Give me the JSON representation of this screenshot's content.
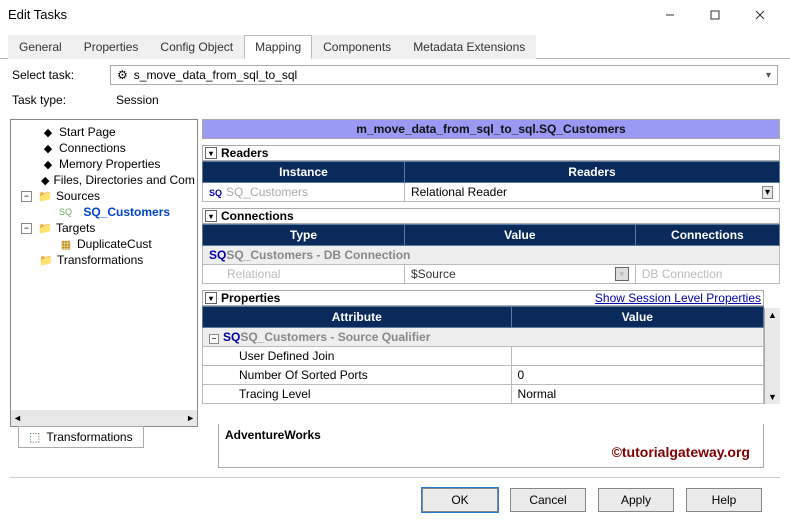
{
  "window": {
    "title": "Edit Tasks"
  },
  "tabs": [
    {
      "label": "General"
    },
    {
      "label": "Properties"
    },
    {
      "label": "Config Object"
    },
    {
      "label": "Mapping"
    },
    {
      "label": "Components"
    },
    {
      "label": "Metadata Extensions"
    }
  ],
  "active_tab": 3,
  "task": {
    "select_label": "Select task:",
    "value": "s_move_data_from_sql_to_sql",
    "type_label": "Task type:",
    "type_value": "Session"
  },
  "tree": {
    "items": [
      "Start Page",
      "Connections",
      "Memory Properties",
      "Files, Directories and Com"
    ],
    "sources": {
      "label": "Sources",
      "children": [
        "SQ_Customers"
      ]
    },
    "targets": {
      "label": "Targets",
      "children": [
        "DuplicateCust"
      ]
    },
    "transformations": {
      "label": "Transformations"
    }
  },
  "mapping_title": "m_move_data_from_sql_to_sql.SQ_Customers",
  "readers": {
    "title": "Readers",
    "headers": [
      "Instance",
      "Readers"
    ],
    "row": {
      "instance": "SQ_Customers",
      "reader": "Relational Reader"
    }
  },
  "connections": {
    "title": "Connections",
    "headers": [
      "Type",
      "Value",
      "Connections"
    ],
    "group": "SQ_Customers - DB Connection",
    "relational_label": "Relational",
    "source_value": "$Source",
    "conn_label": "DB Connection"
  },
  "properties": {
    "title": "Properties",
    "link": "Show Session Level Properties",
    "headers": [
      "Attribute",
      "Value"
    ],
    "group": "SQ_Customers - Source Qualifier",
    "rows": [
      {
        "attr": "User Defined Join",
        "val": ""
      },
      {
        "attr": "Number Of Sorted Ports",
        "val": "0"
      },
      {
        "attr": "Tracing Level",
        "val": "Normal"
      }
    ]
  },
  "transform_tab": "Transformations",
  "adventure": "AdventureWorks",
  "watermark": "©tutorialgateway.org",
  "buttons": {
    "ok": "OK",
    "cancel": "Cancel",
    "apply": "Apply",
    "help": "Help"
  }
}
